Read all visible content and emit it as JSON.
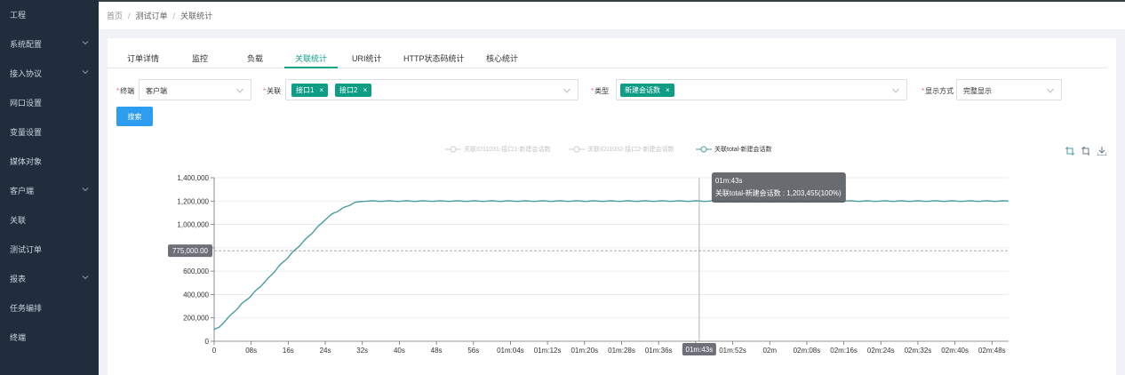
{
  "sidebar": {
    "items": [
      {
        "label": "工程",
        "chevron": false
      },
      {
        "label": "系统配置",
        "chevron": true
      },
      {
        "label": "接入协议",
        "chevron": true
      },
      {
        "label": "网口设置",
        "chevron": false
      },
      {
        "label": "变量设置",
        "chevron": false
      },
      {
        "label": "媒体对象",
        "chevron": false
      },
      {
        "label": "客户端",
        "chevron": true
      },
      {
        "label": "关联",
        "chevron": false
      },
      {
        "label": "测试订单",
        "chevron": false
      },
      {
        "label": "报表",
        "chevron": true
      },
      {
        "label": "任务编排",
        "chevron": false
      },
      {
        "label": "终端",
        "chevron": false
      }
    ]
  },
  "breadcrumb": {
    "home": "首页",
    "sep": "/",
    "parent": "测试订单",
    "current": "关联统计"
  },
  "tabs": [
    {
      "label": "订单详情"
    },
    {
      "label": "监控"
    },
    {
      "label": "负载"
    },
    {
      "label": "关联统计",
      "active": true
    },
    {
      "label": "URI统计"
    },
    {
      "label": "HTTP状态码统计"
    },
    {
      "label": "核心统计"
    }
  ],
  "filters": {
    "endpoint": {
      "label": "终端",
      "value": "客户端"
    },
    "association": {
      "label": "关联",
      "tags": [
        "接口1",
        "接口2"
      ]
    },
    "type": {
      "label": "类型",
      "tags": [
        "新建会话数"
      ]
    },
    "display": {
      "label": "显示方式",
      "value": "完整显示"
    }
  },
  "search_button": "搜索",
  "legend": [
    {
      "label": "关联ID11031-接口1-新建会话数",
      "color": "#c9cdd2",
      "active": false
    },
    {
      "label": "关联ID11032-接口2-新建会话数",
      "color": "#c9cdd2",
      "active": false
    },
    {
      "label": "关联total-新建会话数",
      "color": "#4a9ca1",
      "active": true
    }
  ],
  "toolbox": {
    "icons": [
      "zoom-icon",
      "zoom-reset-icon",
      "download-icon"
    ]
  },
  "tooltip": {
    "title": "01m:43s",
    "text": "关联total-新建会话数 : 1,203,455(100%)"
  },
  "pointer": {
    "y_label": "775,000.00",
    "x_label": "01m:43s"
  },
  "chart_data": {
    "type": "line",
    "series": [
      {
        "name": "关联total-新建会话数",
        "color": "#4a9ca1"
      }
    ],
    "ylim": [
      0,
      1400000
    ],
    "y_ticks": [
      "0",
      "200,000",
      "400,000",
      "600,000",
      "800,000",
      "1,000,000",
      "1,200,000",
      "1,400,000"
    ],
    "x_ticks": [
      "0",
      "08s",
      "16s",
      "24s",
      "32s",
      "40s",
      "48s",
      "56s",
      "01m:04s",
      "01m:12s",
      "01m:20s",
      "01m:28s",
      "01m:36s",
      "01m:43s",
      "01m:52s",
      "02m",
      "02m:08s",
      "02m:16s",
      "02m:24s",
      "02m:32s",
      "02m:40s",
      "02m:48s"
    ],
    "points_x_seconds": [
      0,
      1,
      2,
      4,
      6,
      8,
      10,
      12,
      14,
      16,
      18,
      20,
      22,
      24,
      26,
      28,
      30,
      32,
      172
    ],
    "points_y": [
      100000,
      115000,
      160000,
      240000,
      320000,
      390000,
      470000,
      550000,
      640000,
      720000,
      800000,
      880000,
      960000,
      1040000,
      1100000,
      1140000,
      1180000,
      1200000,
      1200000
    ],
    "crosshair_y": 775000,
    "crosshair_x": "01m:43s"
  }
}
